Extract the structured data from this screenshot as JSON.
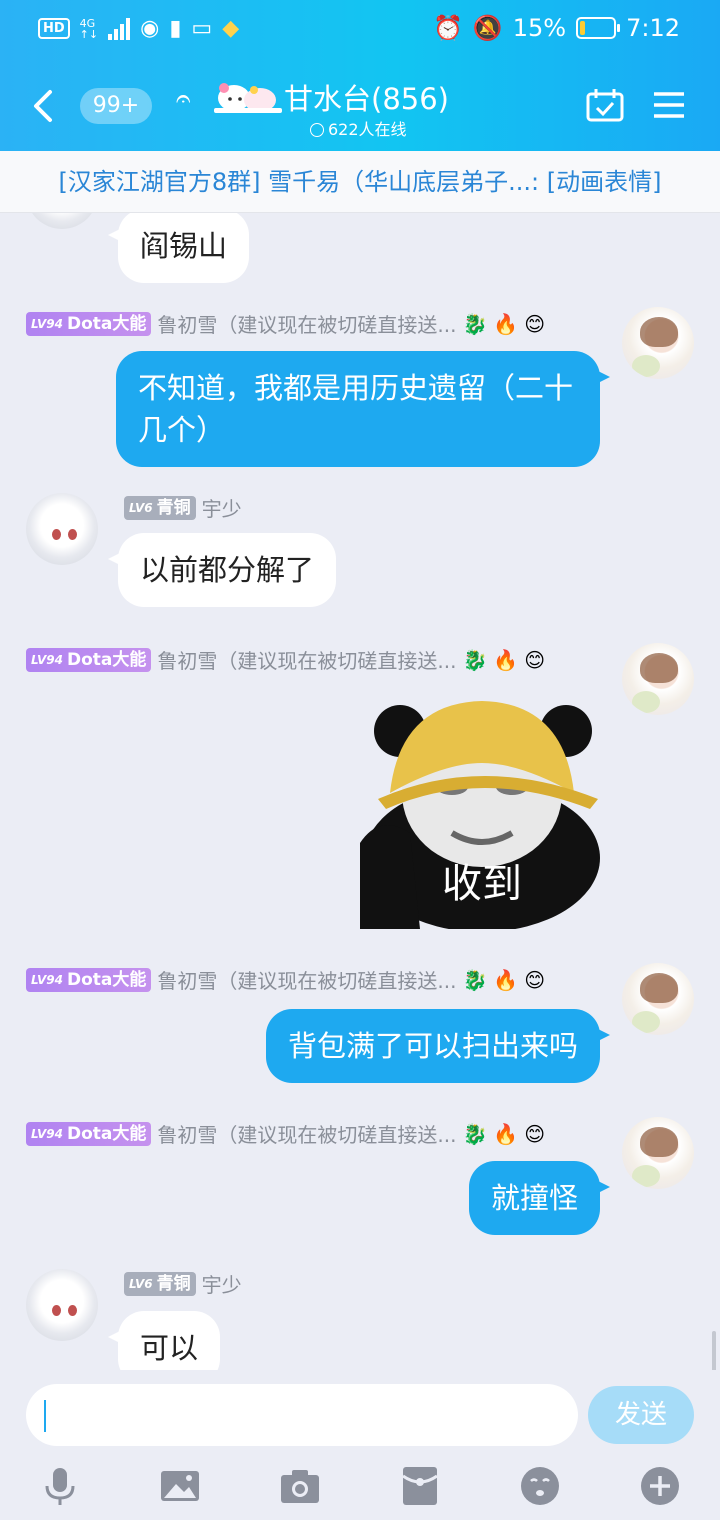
{
  "status_bar": {
    "left_icons": [
      "hd-icon",
      "4g-signal-icon",
      "signal-bars-icon",
      "eye-icon",
      "sim-icon",
      "book-icon",
      "app-icon"
    ],
    "battery_percent": "15%",
    "battery_level": 0.15,
    "time": "7:12"
  },
  "header": {
    "unread_count": "99+",
    "title": "甘水台(856)",
    "online": "622人在线"
  },
  "notice": "[汉家江湖官方8群] 雪千易（华山底层弟子...: [动画表情]",
  "messages": [
    {
      "side": "left",
      "text": "阎锡山"
    },
    {
      "side": "right",
      "level": "LV94",
      "title": "Dota大能",
      "sender": "鲁初雪（建议现在被切磋直接送...",
      "text": "不知道，我都是用历史遗留（二十几个）"
    },
    {
      "side": "left",
      "level": "LV6",
      "title": "青铜",
      "sender": "宇少",
      "text": "以前都分解了"
    },
    {
      "side": "right",
      "level": "LV94",
      "title": "Dota大能",
      "sender": "鲁初雪（建议现在被切磋直接送...",
      "sticker_text": "收到"
    },
    {
      "side": "right",
      "level": "LV94",
      "title": "Dota大能",
      "sender": "鲁初雪（建议现在被切磋直接送...",
      "text": "背包满了可以扫出来吗"
    },
    {
      "side": "right",
      "level": "LV94",
      "title": "Dota大能",
      "sender": "鲁初雪（建议现在被切磋直接送...",
      "text": "就撞怪"
    },
    {
      "side": "left",
      "level": "LV6",
      "title": "青铜",
      "sender": "宇少",
      "text": "可以"
    }
  ],
  "input": {
    "value": "",
    "send_label": "发送"
  },
  "toolbar": [
    "microphone-icon",
    "image-icon",
    "camera-icon",
    "red-packet-icon",
    "emoji-icon",
    "plus-icon"
  ]
}
